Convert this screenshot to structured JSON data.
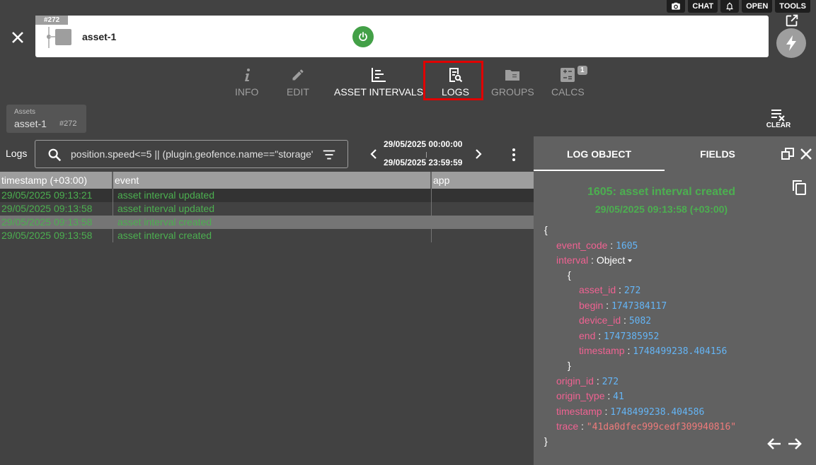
{
  "topbar": {
    "camera_icon": "camera-icon",
    "chat": "CHAT",
    "bell_icon": "bell-icon",
    "open": "OPEN",
    "tools": "TOOLS"
  },
  "header": {
    "badge": "#272",
    "title": "asset-1",
    "status_color": "#43a047"
  },
  "tabs": [
    {
      "label": "INFO",
      "icon": "info-icon",
      "active": false
    },
    {
      "label": "EDIT",
      "icon": "pencil-icon",
      "active": false
    },
    {
      "label": "ASSET INTERVALS",
      "icon": "chart-bar-icon",
      "active": true
    },
    {
      "label": "LOGS",
      "icon": "logs-search-icon",
      "active": true
    },
    {
      "label": "GROUPS",
      "icon": "folder-icon",
      "active": false
    },
    {
      "label": "CALCS",
      "icon": "calculator-icon",
      "active": false,
      "badge": "1"
    }
  ],
  "breadcrumb": {
    "label": "Assets",
    "name": "asset-1",
    "id": "#272"
  },
  "clear": "CLEAR",
  "logs": {
    "label": "Logs",
    "search_value": "position.speed<=5 || (plugin.geofence.name==\"storage\")",
    "date_from": "29/05/2025 00:00:00",
    "date_to": "29/05/2025 23:59:59"
  },
  "table": {
    "headers": [
      "timestamp (+03:00)",
      "event",
      "app"
    ],
    "rows": [
      {
        "timestamp": "29/05/2025 09:13:21",
        "event": "asset interval updated",
        "app": ""
      },
      {
        "timestamp": "29/05/2025 09:13:58",
        "event": "asset interval updated",
        "app": ""
      },
      {
        "timestamp": "29/05/2025 09:13:58",
        "event": "asset interval created",
        "app": ""
      },
      {
        "timestamp": "29/05/2025 09:13:58",
        "event": "asset interval created",
        "app": ""
      }
    ],
    "selected_row": 2
  },
  "panel": {
    "tab_log_object": "LOG OBJECT",
    "tab_fields": "FIELDS",
    "title": "1605: asset interval created",
    "subtitle": "29/05/2025 09:13:58 (+03:00)",
    "open_brace": "{",
    "close_brace": "}",
    "event_code_key": "event_code",
    "event_code_val": "1605",
    "interval_key": "interval",
    "interval_type": "Object",
    "asset_id_key": "asset_id",
    "asset_id_val": "272",
    "begin_key": "begin",
    "begin_val": "1747384117",
    "device_id_key": "device_id",
    "device_id_val": "5082",
    "end_key": "end",
    "end_val": "1747385952",
    "itimestamp_key": "timestamp",
    "itimestamp_val": "1748499238.404156",
    "origin_id_key": "origin_id",
    "origin_id_val": "272",
    "origin_type_key": "origin_type",
    "origin_type_val": "41",
    "timestamp_key": "timestamp",
    "timestamp_val": "1748499238.404586",
    "trace_key": "trace",
    "trace_val": "\"41da0dfec999cedf309940816\"",
    "colon": ":"
  }
}
